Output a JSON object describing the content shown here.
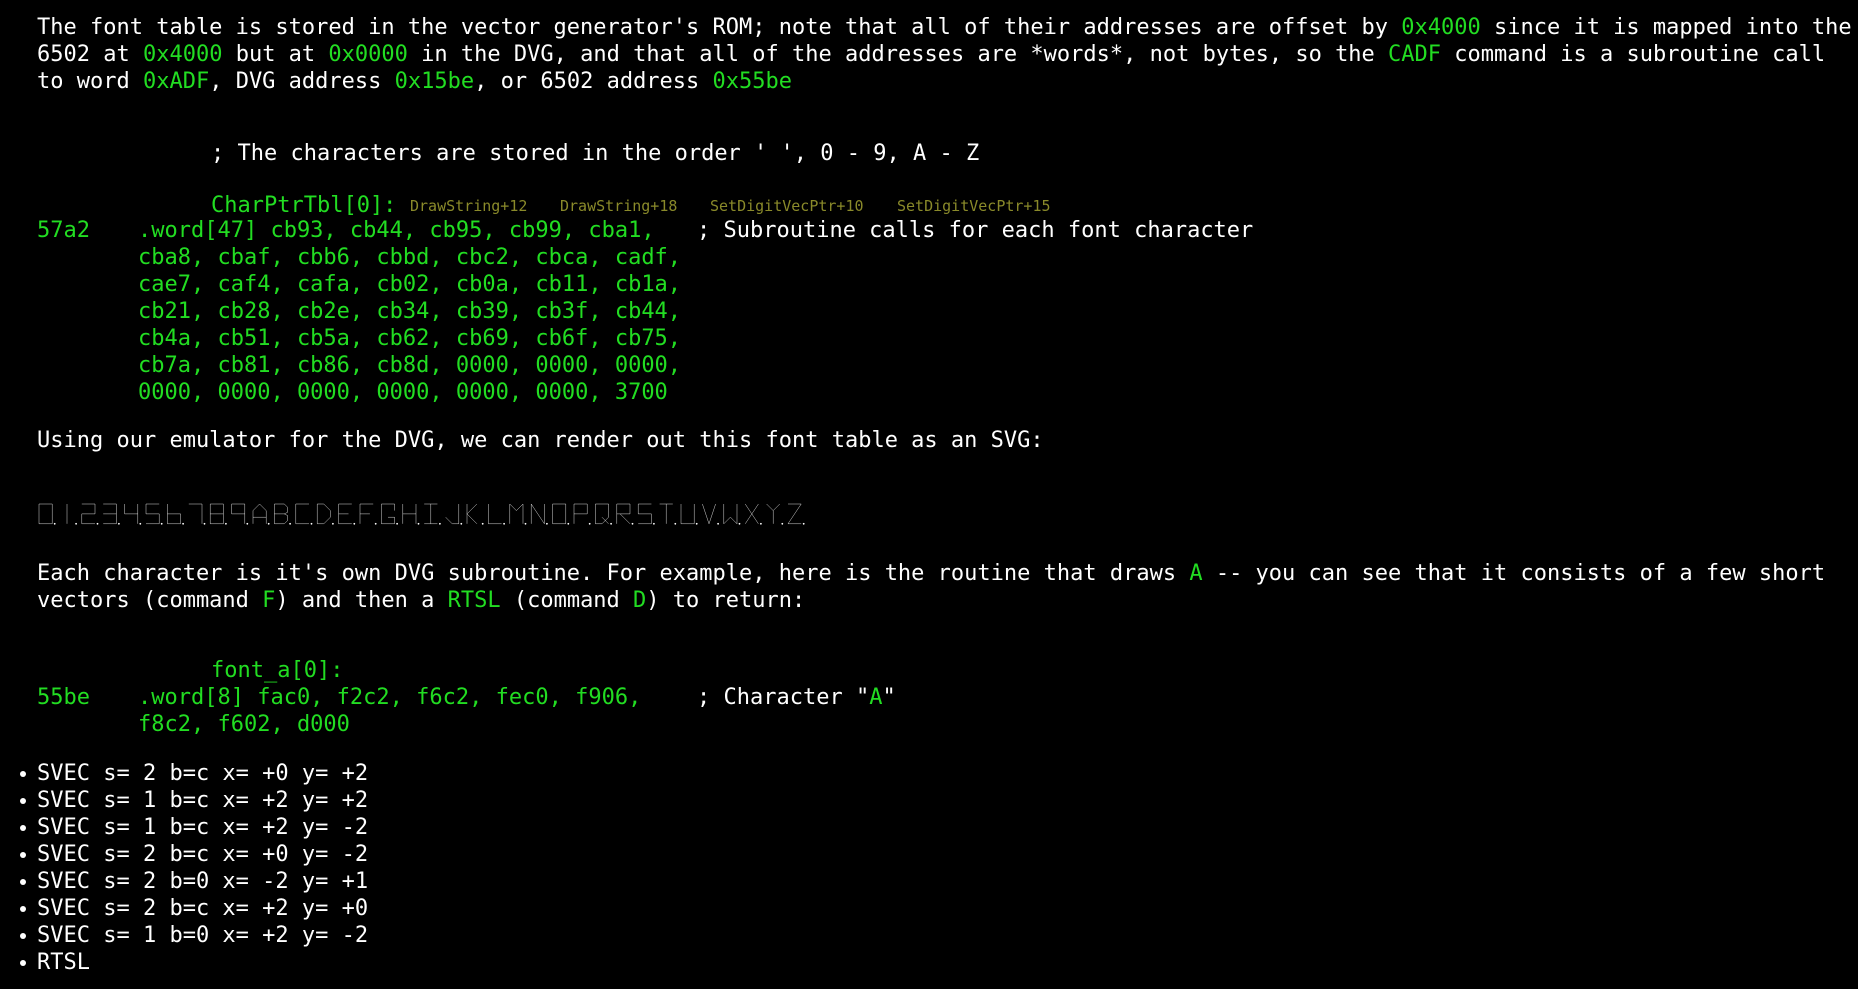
{
  "intro": {
    "line1_pre": "The font table is stored in the vector generator's ROM; note that all of their addresses are offset by ",
    "line1_hl": "0x4000",
    "line1_post": " since it is mapped into the",
    "line2_a": "6502 at ",
    "line2_hl1": "0x4000",
    "line2_b": " but at ",
    "line2_hl2": "0x0000",
    "line2_c": " in the DVG, and that all of the addresses are *words*, not bytes, so the ",
    "line2_hl3": "CADF",
    "line2_d": " command is a subroutine call",
    "line3_a": "to word ",
    "line3_hl1": "0xADF",
    "line3_b": ", DVG address ",
    "line3_hl2": "0x15be",
    "line3_c": ", or 6502 address ",
    "line3_hl3": "0x55be"
  },
  "char_table": {
    "comment": "; The characters are stored in the order ' ', 0 - 9, A - Z",
    "label": "CharPtrTbl[0]:",
    "xrefs": [
      "DrawString+12",
      "DrawString+18",
      "SetDigitVecPtr+10",
      "SetDigitVecPtr+15"
    ],
    "address": "57a2",
    "first_line": ".word[47] cb93, cb44, cb95, cb99, cba1,",
    "trailing_comment": "; Subroutine calls for each font character",
    "lines": [
      "cba8, cbaf, cbb6, cbbd, cbc2, cbca, cadf,",
      "cae7, caf4, cafa, cb02, cb0a, cb11, cb1a,",
      "cb21, cb28, cb2e, cb34, cb39, cb3f, cb44,",
      "cb4a, cb51, cb5a, cb62, cb69, cb6f, cb75,",
      "cb7a, cb81, cb86, cb8d, 0000, 0000, 0000,",
      "0000, 0000, 0000, 0000, 0000, 0000, 3700"
    ]
  },
  "svg_intro": "Using our emulator for the DVG, we can render out this font table as an SVG:",
  "rendered_glyphs": "0123456789ABCDEFGHIJKLMNOPQRSTUVWXYZ",
  "each_char": {
    "line1_pre": "Each character is it's own DVG subroutine. For example, here is the routine that draws ",
    "line1_hl": "A",
    "line1_post": " -- you can see that it consists of a few short",
    "line2_a": "vectors (command ",
    "line2_hl1": "F",
    "line2_b": ") and then a ",
    "line2_hl2": "RTSL",
    "line2_c": " (command ",
    "line2_hl3": "D",
    "line2_d": ") to return:"
  },
  "font_a": {
    "label": "font_a[0]:",
    "address": "55be",
    "first_line": ".word[8] fac0, f2c2, f6c2, fec0, f906,",
    "comment_pre": "; Character \"",
    "comment_hl": "A",
    "comment_post": "\"",
    "line2": "f8c2, f602, d000"
  },
  "font_a_bullets": [
    "SVEC s= 2 b=c x= +0 y= +2",
    "SVEC s= 1 b=c x= +2 y= +2",
    "SVEC s= 1 b=c x= +2 y= -2",
    "SVEC s= 2 b=c x= +0 y= -2",
    "SVEC s= 2 b=0 x= -2 y= +1",
    "SVEC s= 2 b=c x= +2 y= +0",
    "SVEC s= 1 b=0 x= +2 y= -2",
    "RTSL"
  ]
}
